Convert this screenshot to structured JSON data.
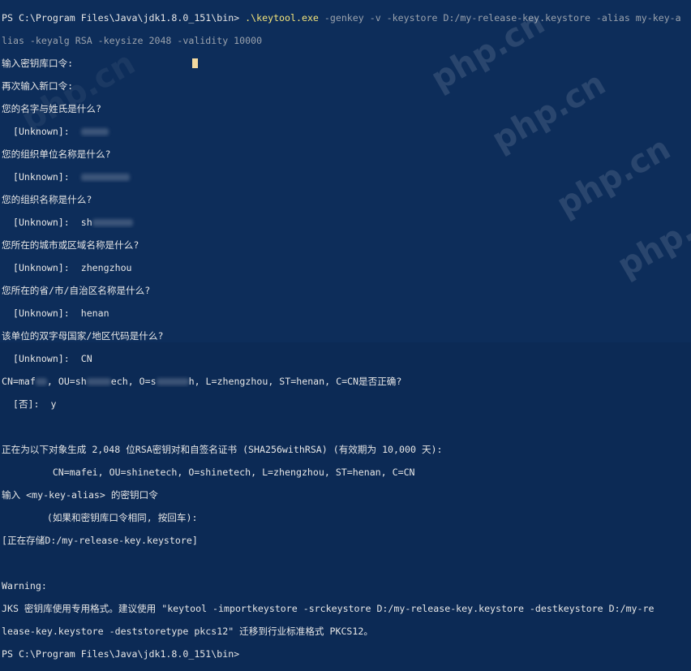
{
  "terminal": {
    "prompt1": "PS C:\\Program Files\\Java\\jdk1.8.0_151\\bin> ",
    "cmd_dot": ".\\",
    "cmd_tool": "keytool.exe",
    "cmd_args": " -genkey -v -keystore D:/my-release-key.keystore -alias my-key-a",
    "cmd_cont": "lias -keyalg RSA -keysize 2048 -validity 10000",
    "line_enter_pw": "输入密钥库口令:",
    "line_reenter_pw": "再次输入新口令:",
    "q_name": "您的名字与姓氏是什么?",
    "a_name": "  [Unknown]:  ",
    "q_unit": "您的组织单位名称是什么?",
    "a_unit": "  [Unknown]:  ",
    "q_org": "您的组织名称是什么?",
    "a_org": "  [Unknown]:  sh",
    "q_city": "您所在的城市或区域名称是什么?",
    "a_city": "  [Unknown]:  zhengzhou",
    "q_state": "您所在的省/市/自治区名称是什么?",
    "a_state": "  [Unknown]:  henan",
    "q_country": "该单位的双字母国家/地区代码是什么?",
    "a_country": "  [Unknown]:  CN",
    "confirm_a": "CN=maf",
    "confirm_b": ", OU=sh",
    "confirm_c": "ech, O=s",
    "confirm_d": "h, L=zhengzhou, ST=henan, C=CN是否正确?",
    "confirm_answer": "  [否]:  y",
    "gen_line": "正在为以下对象生成 2,048 位RSA密钥对和自签名证书 (SHA256withRSA) (有效期为 10,000 天):",
    "gen_dn": "         CN=mafei, OU=shinetech, O=shinetech, L=zhengzhou, ST=henan, C=CN",
    "key_pw": "输入 <my-key-alias> 的密钥口令",
    "key_pw_hint": "        (如果和密钥库口令相同, 按回车):",
    "storing": "[正在存储D:/my-release-key.keystore]",
    "warning": "Warning:",
    "warn_1": "JKS 密钥库使用专用格式。建议使用 \"keytool -importkeystore -srckeystore D:/my-release-key.keystore -destkeystore D:/my-re",
    "warn_2": "lease-key.keystore -deststoretype pkcs12\" 迁移到行业标准格式 PKCS12。",
    "prompt2": "PS C:\\Program Files\\Java\\jdk1.8.0_151\\bin>"
  },
  "watermark": "php.cn",
  "colors": {
    "background": "#0d2d5a",
    "text": "#e6e6e6",
    "command_tool": "#f2e37a",
    "command_args": "#9aa2ad"
  }
}
